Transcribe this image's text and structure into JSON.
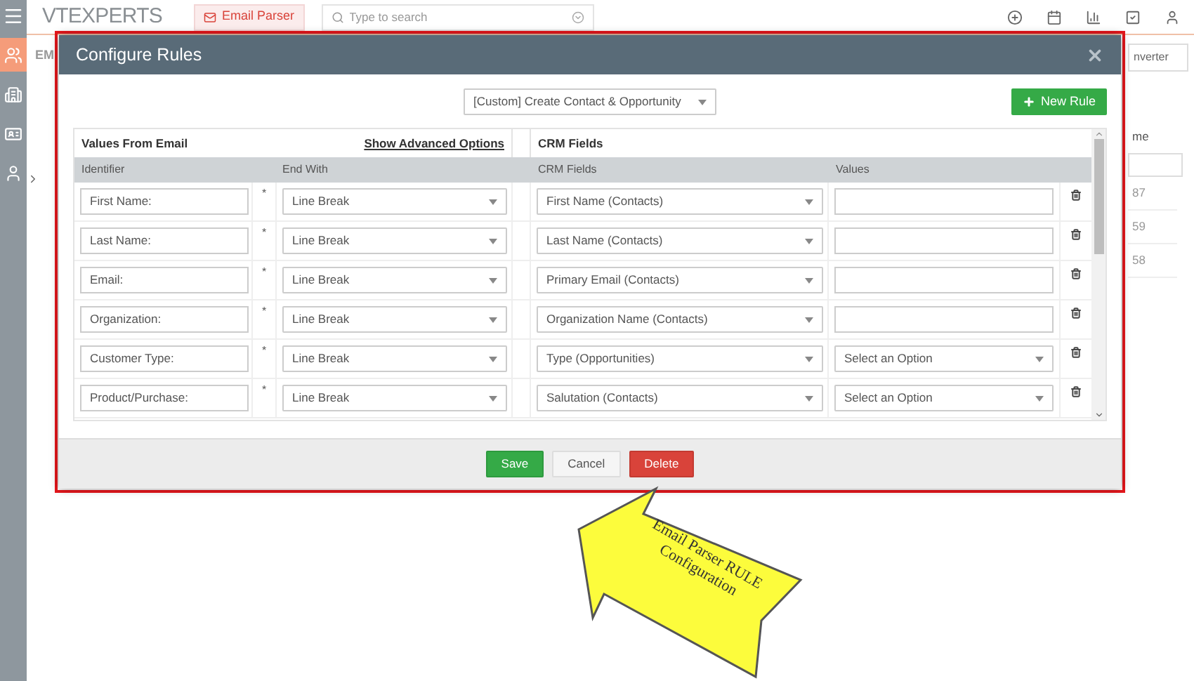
{
  "top_bar": {
    "logo": "VTEXPERTS",
    "module_tab": "Email Parser",
    "search": {
      "placeholder": "Type to search"
    }
  },
  "sidebar": {
    "items": [
      {
        "selected": true
      },
      {
        "selected": false
      },
      {
        "selected": false
      },
      {
        "selected": false
      }
    ]
  },
  "background": {
    "heading": "EM",
    "button": "nverter",
    "column_label": "me",
    "cells": [
      "87",
      "59",
      "58"
    ]
  },
  "dialog": {
    "title": "Configure Rules",
    "rule_select": "[Custom] Create Contact & Opportunity",
    "new_rule_button": "New Rule",
    "left_heading": "Values From Email",
    "advanced_link": "Show Advanced Options",
    "right_heading": "CRM Fields",
    "columns": [
      "Identifier",
      "End With",
      "CRM Fields",
      "Values"
    ],
    "rows": [
      {
        "identifier": "First Name:",
        "end_with": "Line Break",
        "crm_field": "First Name (Contacts)",
        "value": {
          "kind": "text"
        }
      },
      {
        "identifier": "Last Name:",
        "end_with": "Line Break",
        "crm_field": "Last Name (Contacts)",
        "value": {
          "kind": "text"
        }
      },
      {
        "identifier": "Email:",
        "end_with": "Line Break",
        "crm_field": "Primary Email (Contacts)",
        "value": {
          "kind": "text"
        }
      },
      {
        "identifier": "Organization:",
        "end_with": "Line Break",
        "crm_field": "Organization Name (Contacts)",
        "value": {
          "kind": "text"
        }
      },
      {
        "identifier": "Customer Type:",
        "end_with": "Line Break",
        "crm_field": "Type (Opportunities)",
        "value": {
          "kind": "select",
          "text": "Select an Option"
        }
      },
      {
        "identifier": "Product/Purchase:",
        "end_with": "Line Break",
        "crm_field": "Salutation (Contacts)",
        "value": {
          "kind": "select",
          "text": "Select an Option"
        }
      }
    ],
    "required_mark": "*",
    "buttons": [
      {
        "label": "Save",
        "kind": "primary"
      },
      {
        "label": "Cancel",
        "kind": "default"
      },
      {
        "label": "Delete",
        "kind": "danger"
      }
    ]
  },
  "callout": {
    "text": "Email Parser RULE Configuration"
  }
}
